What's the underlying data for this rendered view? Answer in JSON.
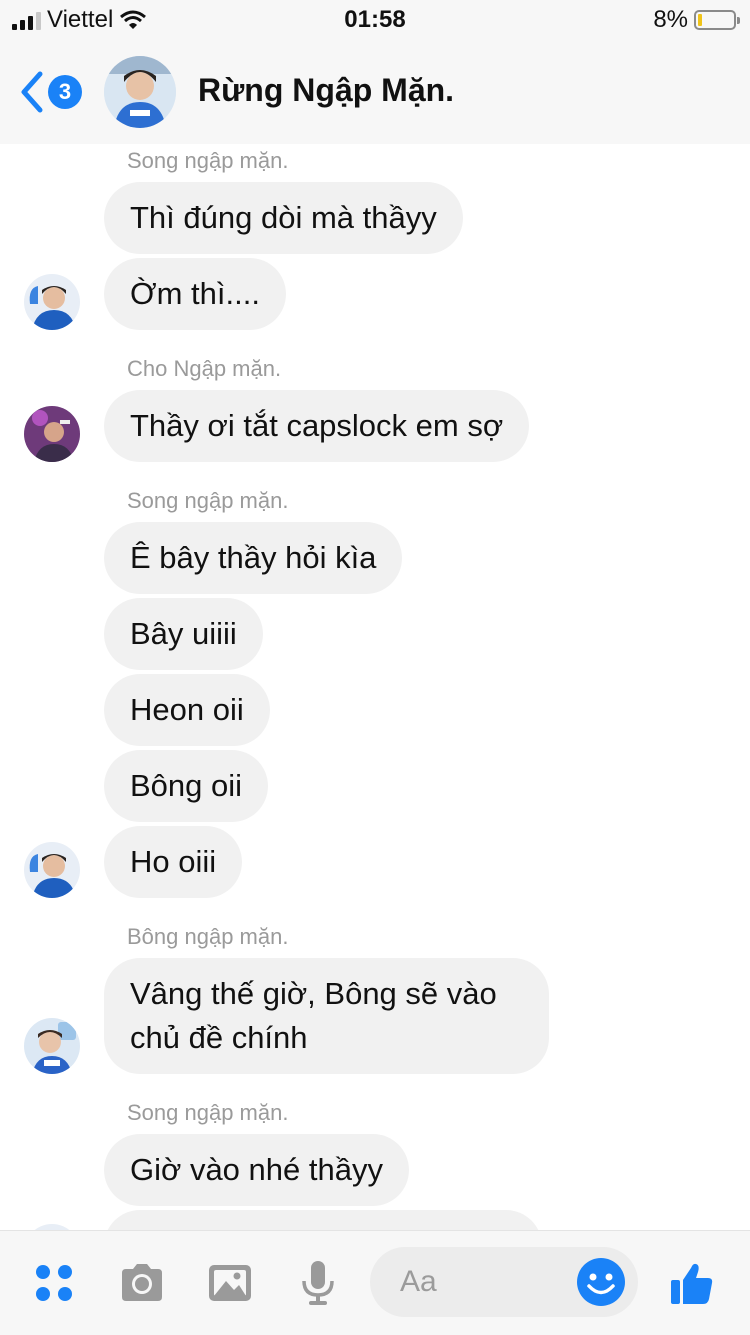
{
  "status_bar": {
    "carrier": "Viettel",
    "time": "01:58",
    "battery_percent": "8%",
    "signal_bars": 4,
    "signal_active": 3,
    "battery_level": 0.08
  },
  "header": {
    "unread_count": "3",
    "title": "Rừng Ngập Mặn.",
    "avatar_icon": "group-avatar"
  },
  "messages": [
    {
      "sender": "Song ngập mặn.",
      "bubbles": [
        "Thì đúng dòi mà thầyy",
        "Ờm thì...."
      ]
    },
    {
      "sender": "Cho Ngập mặn.",
      "bubbles": [
        "Thầy ơi tắt capslock em sợ"
      ]
    },
    {
      "sender": "Song ngập mặn.",
      "bubbles": [
        "Ê bây thầy hỏi kìa",
        "Bây uiiii",
        "Heon oii",
        "Bông oii",
        "Ho oiii"
      ]
    },
    {
      "sender": "Bông ngập mặn.",
      "bubbles": [
        "Vâng thế giờ, Bông sẽ vào chủ đề chính"
      ]
    },
    {
      "sender": "Song ngập mặn.",
      "bubbles": [
        "Giờ vào nhé thầyy"
      ]
    }
  ],
  "composer": {
    "placeholder": "Aa",
    "icons": [
      "apps-icon",
      "camera-icon",
      "image-icon",
      "microphone-icon",
      "emoji-icon",
      "thumbs-up-icon"
    ],
    "accent_color": "#1a82f7"
  }
}
